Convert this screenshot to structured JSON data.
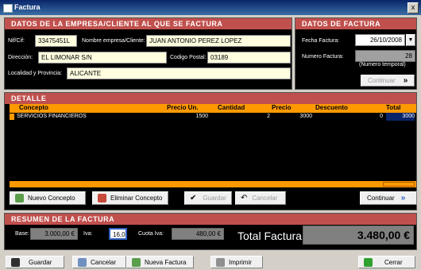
{
  "window": {
    "title": "Factura",
    "close": "x"
  },
  "cliente": {
    "header": "DATOS DE LA EMPRESA/CLIENTE AL QUE SE FACTURA",
    "nif_label": "Nif/Cif:",
    "nif": "33475451L",
    "nombre_label": "Nombre empresa/Cliente:",
    "nombre": "JUAN ANTONIO PEREZ LOPEZ",
    "direccion_label": "Dirección:",
    "direccion": "EL LIMONAR S/N",
    "cp_label": "Codigo Postal:",
    "cp": "03189",
    "localidad_label": "Localidad y Provincia:",
    "localidad": "ALICANTE"
  },
  "factura": {
    "header": "DATOS DE FACTURA",
    "fecha_label": "Fecha Factura:",
    "fecha": "26/10/2008",
    "numero_label": "Numero Factura:",
    "numero": "28",
    "temporal": "(Numero temporal)",
    "continuar": "Continuar"
  },
  "detalle": {
    "header": "DETALLE",
    "columns": [
      "Concepto",
      "Precio Un.",
      "Cantidad",
      "Precio",
      "Descuento",
      "Total"
    ],
    "rows": [
      {
        "concepto": "SERVICIOS FINANCIEROS",
        "precio_un": "1500",
        "cantidad": "2",
        "precio": "3000",
        "descuento": "0",
        "total": "3000"
      }
    ]
  },
  "acciones": {
    "nuevo": "Nuevo Concepto",
    "eliminar": "Eliminar Concepto",
    "guardar": "Guardar",
    "cancelar": "Cancelar",
    "continuar": "Continuar"
  },
  "resumen": {
    "header": "RESUMEN DE LA FACTURA",
    "base_label": "Base:",
    "base": "3.000,00 €",
    "iva_label": "Iva:",
    "iva": "16,00",
    "cuota_label": "Cuota Iva:",
    "cuota": "480,00 €",
    "total_label": "Total Factura:",
    "total": "3.480,00 €"
  },
  "footer": {
    "guardar": "Guardar",
    "cancelar": "Cancelar",
    "nueva": "Nueva Factura",
    "imprimir": "Imprimir",
    "cerrar": "Cerrar"
  }
}
